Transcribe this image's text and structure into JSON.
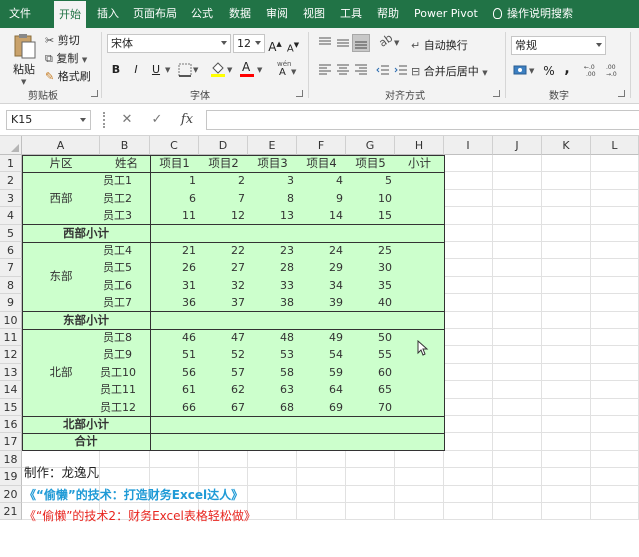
{
  "ribbon_tabs": [
    "文件",
    "开始",
    "插入",
    "页面布局",
    "公式",
    "数据",
    "审阅",
    "视图",
    "工具",
    "帮助",
    "Power Pivot",
    "操作说明搜索"
  ],
  "active_tab": "开始",
  "clipboard": {
    "paste": "粘贴",
    "cut": "剪切",
    "copy": "复制",
    "format_painter": "格式刷",
    "group": "剪贴板"
  },
  "font": {
    "name": "宋体",
    "size": "12",
    "grow": "A",
    "shrink": "A",
    "bold": "B",
    "italic": "I",
    "underline": "U",
    "phonetic": "wén",
    "group": "字体"
  },
  "alignment": {
    "wrap": "自动换行",
    "merge": "合并后居中",
    "group": "对齐方式"
  },
  "number": {
    "format": "常规",
    "percent": "%",
    "comma": ",",
    "group": "数字"
  },
  "formula_bar": {
    "cell_ref": "K15",
    "fx": "fx",
    "cancel": "✕",
    "enter": "✓",
    "content": ""
  },
  "columns": [
    "A",
    "B",
    "C",
    "D",
    "E",
    "F",
    "G",
    "H",
    "I",
    "J",
    "K",
    "L"
  ],
  "rows": [
    "1",
    "2",
    "3",
    "4",
    "5",
    "6",
    "7",
    "8",
    "9",
    "10",
    "11",
    "12",
    "13",
    "14",
    "15",
    "16",
    "17",
    "18",
    "19",
    "20",
    "21"
  ],
  "table": {
    "header": {
      "region": "片区",
      "name": "姓名",
      "items": [
        "项目1",
        "项目2",
        "项目3",
        "项目4",
        "项目5"
      ],
      "subtotal": "小计"
    },
    "groups": [
      {
        "region": "西部",
        "subtotal_label": "西部小计",
        "rows": [
          {
            "name": "员工1",
            "values": [
              1,
              2,
              3,
              4,
              5
            ]
          },
          {
            "name": "员工2",
            "values": [
              6,
              7,
              8,
              9,
              10
            ]
          },
          {
            "name": "员工3",
            "values": [
              11,
              12,
              13,
              14,
              15
            ]
          }
        ]
      },
      {
        "region": "东部",
        "subtotal_label": "东部小计",
        "rows": [
          {
            "name": "员工4",
            "values": [
              21,
              22,
              23,
              24,
              25
            ]
          },
          {
            "name": "员工5",
            "values": [
              26,
              27,
              28,
              29,
              30
            ]
          },
          {
            "name": "员工6",
            "values": [
              31,
              32,
              33,
              34,
              35
            ]
          },
          {
            "name": "员工7",
            "values": [
              36,
              37,
              38,
              39,
              40
            ]
          }
        ]
      },
      {
        "region": "北部",
        "subtotal_label": "北部小计",
        "rows": [
          {
            "name": "员工8",
            "values": [
              46,
              47,
              48,
              49,
              50
            ]
          },
          {
            "name": "员工9",
            "values": [
              51,
              52,
              53,
              54,
              55
            ]
          },
          {
            "name": "员工10",
            "values": [
              56,
              57,
              58,
              59,
              60
            ]
          },
          {
            "name": "员工11",
            "values": [
              61,
              62,
              63,
              64,
              65
            ]
          },
          {
            "name": "员工12",
            "values": [
              66,
              67,
              68,
              69,
              70
            ]
          }
        ]
      }
    ],
    "total_label": "合计"
  },
  "notes": {
    "author": "制作：龙逸凡",
    "book1": "《“偷懒”的技术：打造财务Excel达人》",
    "book2": "《“偷懒”的技术2：财务Excel表格轻松做》"
  },
  "colors": {
    "accent": "#217346",
    "table_fill": "#ccffcc",
    "book1": "#1f9ad6",
    "book2": "#e8251f"
  }
}
